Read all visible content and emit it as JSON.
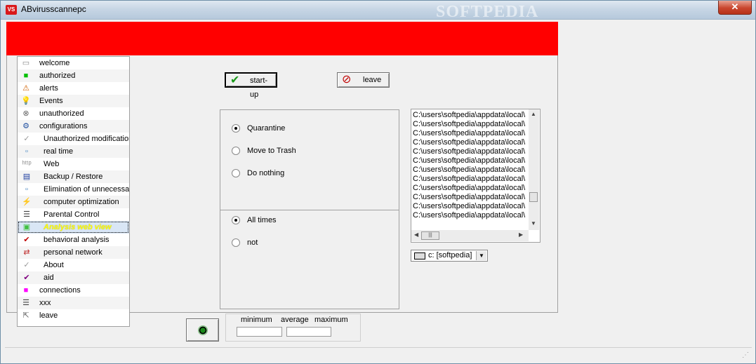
{
  "window": {
    "title": "ABvirusscannepc",
    "icon_text": "VS",
    "watermark": "SOFTPEDIA",
    "close_glyph": "✕"
  },
  "banner_color": "#ff0000",
  "sidebar": {
    "items": [
      {
        "label": "welcome",
        "icon": "welcome-icon",
        "glyph": "▭",
        "color": "#888"
      },
      {
        "label": "authorized",
        "icon": "green-square-icon",
        "glyph": "■",
        "color": "#00c000"
      },
      {
        "label": "alerts",
        "icon": "alert-figure-icon",
        "glyph": "⚠",
        "color": "#d06000"
      },
      {
        "label": "Events",
        "icon": "lightbulb-icon",
        "glyph": "💡",
        "color": "#d0a000"
      },
      {
        "label": "unauthorized",
        "icon": "no-entry-icon",
        "glyph": "⊗",
        "color": "#666"
      },
      {
        "label": "configurations",
        "icon": "settings-key-icon",
        "glyph": "⚙",
        "color": "#2050a0"
      },
      {
        "label": "Unauthorized modification",
        "icon": "check-small-icon",
        "glyph": "✓",
        "color": "#999",
        "sub": true
      },
      {
        "label": "real time",
        "icon": "chart-icon",
        "glyph": "▫",
        "color": "#4080c0",
        "sub": true
      },
      {
        "label": "Web",
        "icon": "web-text-icon",
        "glyph": "ʰᵗᵗᵖ",
        "color": "#888",
        "sub": true
      },
      {
        "label": "Backup / Restore",
        "icon": "backup-icon",
        "glyph": "▤",
        "color": "#2040a0",
        "sub": true
      },
      {
        "label": "Elimination of unnecessary",
        "icon": "cleanup-icon",
        "glyph": "▫",
        "color": "#4080c0",
        "sub": true
      },
      {
        "label": "computer optimization",
        "icon": "lightning-icon",
        "glyph": "⚡",
        "color": "#3050c0",
        "sub": true
      },
      {
        "label": "Parental Control",
        "icon": "list-icon",
        "glyph": "☰",
        "color": "#444",
        "sub": true
      },
      {
        "label": "Analysis web view",
        "icon": "green-box-icon",
        "glyph": "▣",
        "color": "#40c040",
        "sub": true,
        "selected": true
      },
      {
        "label": "behavioral analysis",
        "icon": "red-check-icon",
        "glyph": "✔",
        "color": "#c00000",
        "sub": true
      },
      {
        "label": "personal network",
        "icon": "network-icon",
        "glyph": "⇄",
        "color": "#c03030",
        "sub": true
      },
      {
        "label": "About",
        "icon": "about-check-icon",
        "glyph": "✓",
        "color": "#999",
        "sub": true
      },
      {
        "label": "aid",
        "icon": "aid-check-icon",
        "glyph": "✔",
        "color": "#800080",
        "sub": true
      },
      {
        "label": "connections",
        "icon": "magenta-square-icon",
        "glyph": "■",
        "color": "#ff00ff"
      },
      {
        "label": "xxx",
        "icon": "document-icon",
        "glyph": "☰",
        "color": "#444"
      },
      {
        "label": "leave",
        "icon": "exit-icon",
        "glyph": "⇱",
        "color": "#666"
      }
    ]
  },
  "buttons": {
    "startup_label": "start-up",
    "startup_glyph": "✔",
    "leave_label": "leave",
    "leave_glyph": "⊘"
  },
  "action_group": {
    "options": [
      {
        "label": "Quarantine",
        "checked": true
      },
      {
        "label": "Move to Trash",
        "checked": false
      },
      {
        "label": "Do nothing",
        "checked": false
      }
    ]
  },
  "frequency_group": {
    "options": [
      {
        "label": "All times",
        "checked": true
      },
      {
        "label": "not",
        "checked": false
      }
    ]
  },
  "file_list": {
    "items": [
      "C:\\users\\softpedia\\appdata\\local\\",
      "C:\\users\\softpedia\\appdata\\local\\",
      "C:\\users\\softpedia\\appdata\\local\\",
      "C:\\users\\softpedia\\appdata\\local\\",
      "C:\\users\\softpedia\\appdata\\local\\",
      "C:\\users\\softpedia\\appdata\\local\\",
      "C:\\users\\softpedia\\appdata\\local\\",
      "C:\\users\\softpedia\\appdata\\local\\",
      "C:\\users\\softpedia\\appdata\\local\\",
      "C:\\users\\softpedia\\appdata\\local\\",
      "C:\\users\\softpedia\\appdata\\local\\",
      "C:\\users\\softpedia\\appdata\\local\\"
    ]
  },
  "drive": {
    "selected": "c: [softpedia]"
  },
  "stats": {
    "minimum_label": "minimum",
    "average_label": "average",
    "maximum_label": "maximum",
    "minimum_value": "",
    "average_value": ""
  }
}
